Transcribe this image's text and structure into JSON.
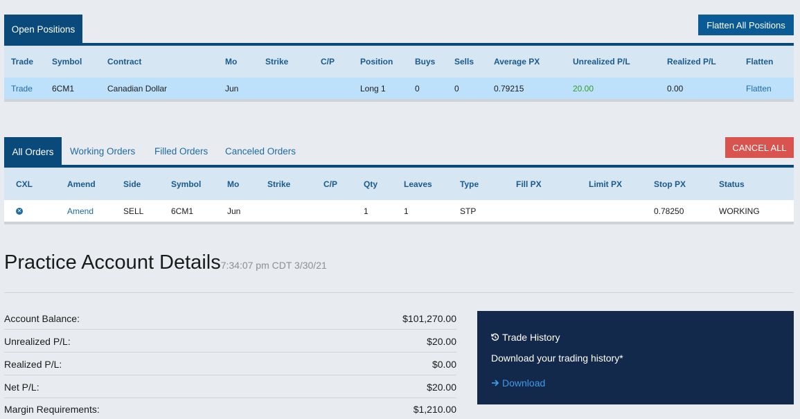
{
  "positions": {
    "tab_label": "Open Positions",
    "flatten_all_label": "Flatten All Positions",
    "columns": [
      "Trade",
      "Symbol",
      "Contract",
      "Mo",
      "Strike",
      "C/P",
      "Position",
      "Buys",
      "Sells",
      "Average PX",
      "Unrealized P/L",
      "Realized P/L",
      "Flatten"
    ],
    "row": {
      "trade": "Trade",
      "symbol": "6CM1",
      "contract": "Canadian Dollar",
      "mo": "Jun",
      "strike": "",
      "cp": "",
      "position": "Long 1",
      "buys": "0",
      "sells": "0",
      "avg_px": "0.79215",
      "unrealized": "20.00",
      "realized": "0.00",
      "flatten": "Flatten"
    }
  },
  "orders": {
    "tabs": [
      "All Orders",
      "Working Orders",
      "Filled Orders",
      "Canceled Orders"
    ],
    "cancel_all_label": "CANCEL ALL",
    "columns": [
      "CXL",
      "Amend",
      "Side",
      "Symbol",
      "Mo",
      "Strike",
      "C/P",
      "Qty",
      "Leaves",
      "Type",
      "Fill PX",
      "Limit PX",
      "Stop PX",
      "Status"
    ],
    "row": {
      "cxl_icon": "x-circle-icon",
      "amend": "Amend",
      "side": "SELL",
      "symbol": "6CM1",
      "mo": "Jun",
      "strike": "",
      "cp": "",
      "qty": "1",
      "leaves": "1",
      "type": "STP",
      "fill_px": "",
      "limit_px": "",
      "stop_px": "0.78250",
      "status": "WORKING"
    }
  },
  "account": {
    "title": "Practice Account Details",
    "timestamp": "7:34:07 pm CDT 3/30/21",
    "rows": [
      {
        "label": "Account Balance:",
        "value": "$101,270.00"
      },
      {
        "label": "Unrealized P/L:",
        "value": "$20.00"
      },
      {
        "label": "Realized P/L:",
        "value": "$0.00"
      },
      {
        "label": "Net P/L:",
        "value": "$20.00"
      },
      {
        "label": "Margin Requirements:",
        "value": "$1,210.00"
      }
    ]
  },
  "history": {
    "icon": "history-icon",
    "title": "Trade History",
    "subtitle": "Download your trading history*",
    "download_icon": "arrow-right-icon",
    "download_label": "Download"
  },
  "colors": {
    "accent": "#0a4a7a",
    "header_bg": "#d6e6f2",
    "selected_row": "#bde0fb",
    "danger": "#d9534f",
    "panel": "#13294b",
    "positive": "#3a9a2e"
  }
}
